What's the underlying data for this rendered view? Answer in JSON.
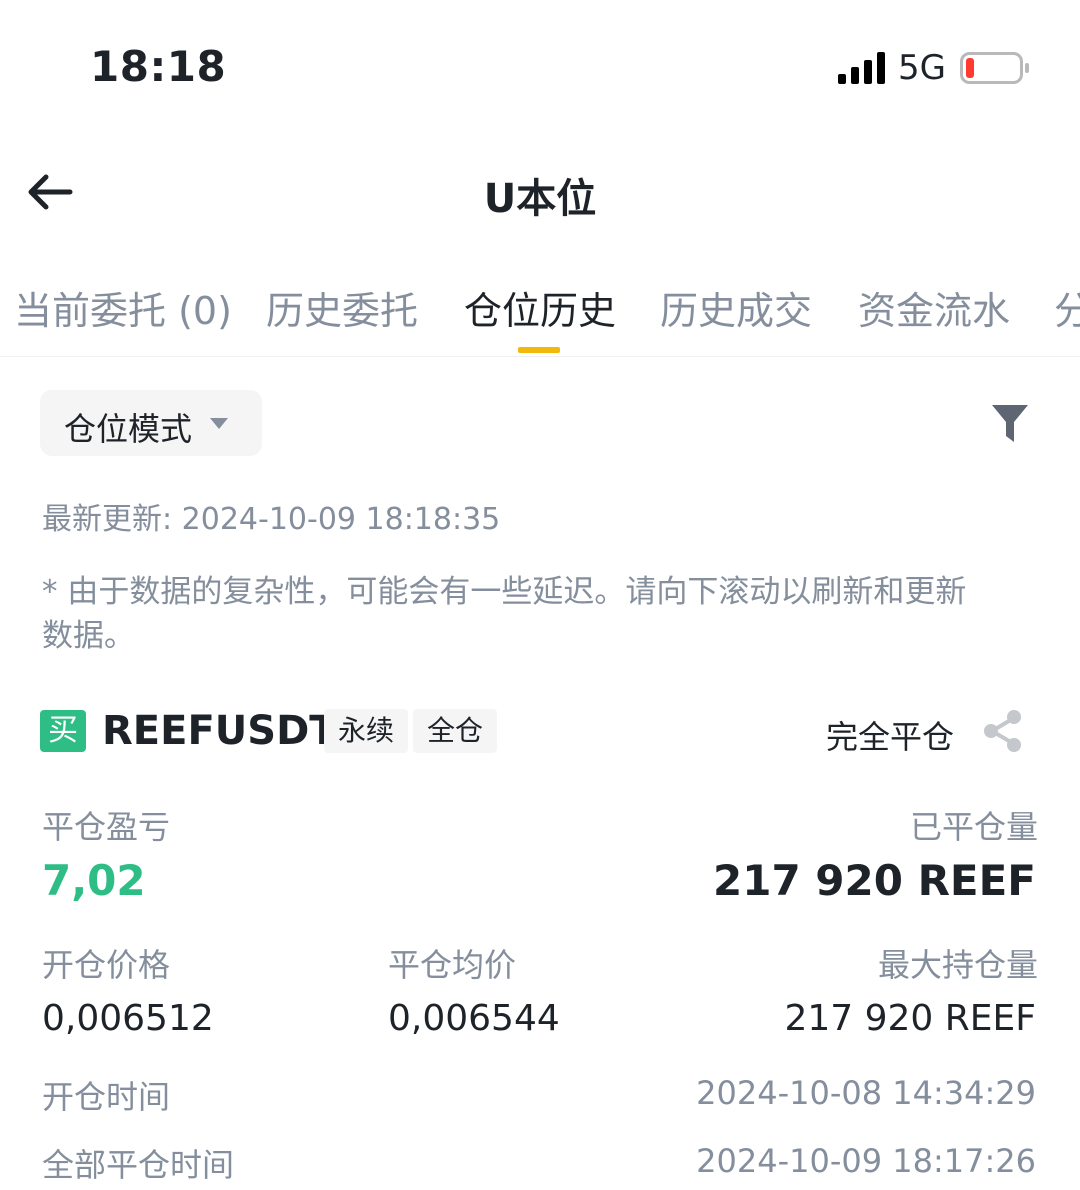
{
  "status_bar": {
    "time": "18:18",
    "network": "5G"
  },
  "header": {
    "title": "U本位"
  },
  "tabs": [
    {
      "label": "当前委托 (0)"
    },
    {
      "label": "历史委托"
    },
    {
      "label": "仓位历史",
      "active": true
    },
    {
      "label": "历史成交"
    },
    {
      "label": "资金流水"
    },
    {
      "label": "分"
    }
  ],
  "mode_selector": {
    "label": "仓位模式"
  },
  "updated": "最新更新: 2024-10-09 18:18:35",
  "notice": "* 由于数据的复杂性，可能会有一些延迟。请向下滚动以刷新和更新数据。",
  "position": {
    "side_badge": "买",
    "symbol": "REEFUSDT",
    "tags": [
      "永续",
      "全仓"
    ],
    "status": "完全平仓",
    "pnl_label": "平仓盈亏",
    "pnl_value": "7,02",
    "closed_qty_label": "已平仓量",
    "closed_qty_value": "217 920 REEF",
    "open_price_label": "开仓价格",
    "open_price_value": "0,006512",
    "avg_close_label": "平仓均价",
    "avg_close_value": "0,006544",
    "max_qty_label": "最大持仓量",
    "max_qty_value": "217 920 REEF",
    "open_time_label": "开仓时间",
    "open_time_value": "2024-10-08 14:34:29",
    "close_time_label": "全部平仓时间",
    "close_time_value": "2024-10-09 18:17:26"
  },
  "colors": {
    "accent": "#f0b90b",
    "buy": "#2ebd85",
    "muted": "#848e9c",
    "text": "#1e2329"
  }
}
